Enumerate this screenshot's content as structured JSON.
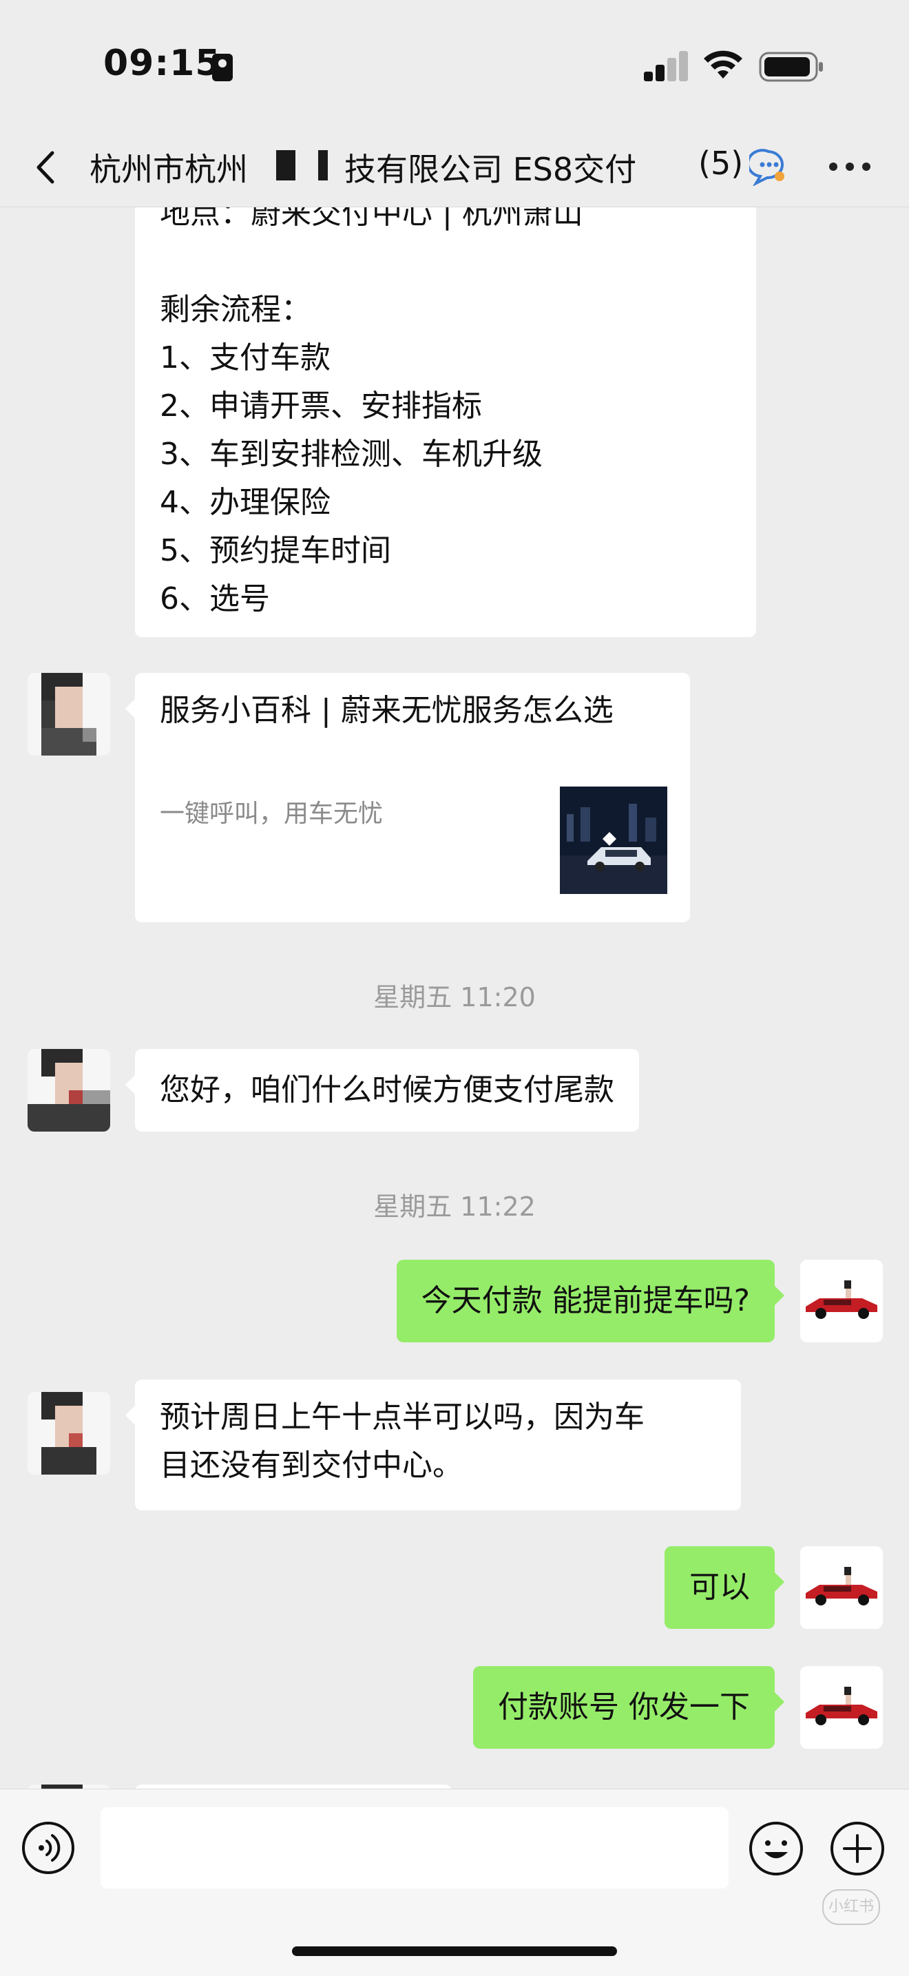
{
  "status_bar": {
    "time": "09:15"
  },
  "nav": {
    "title": "杭州市杭州",
    "title_rest": "技有限公司 ES8交付",
    "member_count": "(5)"
  },
  "messages": {
    "prev_card": {
      "location_line": "地点：蔚来交付中心 | 杭州萧山",
      "remaining_heading": "剩余流程：",
      "steps": [
        "1、支付车款",
        "2、申请开票、安排指标",
        "3、车到安排检测、车机升级",
        "4、办理保险",
        "5、预约提车时间",
        "6、选号"
      ]
    },
    "link_card": {
      "title": "服务小百科 | 蔚来无忧服务怎么选",
      "description": "一键呼叫，用车无忧"
    },
    "timestamp_1": "星期五 11:20",
    "msg_1": "您好，咱们什么时候方便支付尾款",
    "timestamp_2": "星期五 11:22",
    "msg_2": "今天付款 能提前提车吗?",
    "msg_3_line1": "预计周日上午十点半可以吗，因为车",
    "msg_3_line2": "目还没有到交付中心。",
    "msg_4": "可以",
    "msg_5": "付款账号 你发一下"
  },
  "input_bar": {
    "placeholder": "",
    "watermark": "小红书"
  },
  "colors": {
    "background": "#ededed",
    "my_bubble": "#95ec69",
    "other_bubble": "#ffffff",
    "timestamp": "#9a9a9a"
  },
  "icons": [
    "back-icon",
    "chat-info-icon",
    "more-icon",
    "voice-icon",
    "emoji-icon",
    "add-icon"
  ]
}
